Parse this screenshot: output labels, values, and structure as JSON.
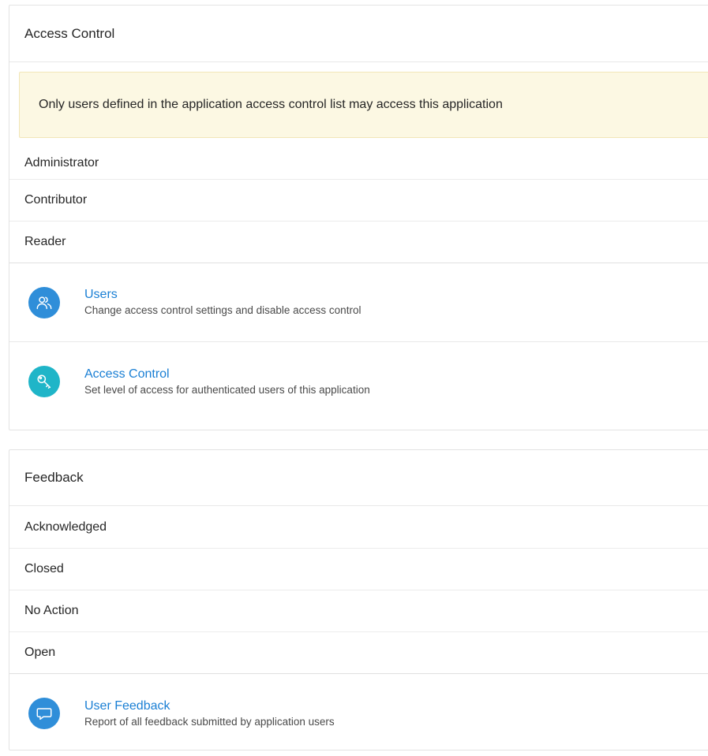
{
  "access_control": {
    "title": "Access Control",
    "alert": "Only users defined in the application access control list may access this application",
    "roles": [
      "Administrator",
      "Contributor",
      "Reader"
    ],
    "links": [
      {
        "title": "Users",
        "description": "Change access control settings and disable access control",
        "icon": "users-icon",
        "color": "#2f8ed9"
      },
      {
        "title": "Access Control",
        "description": "Set level of access for authenticated users of this application",
        "icon": "key-icon",
        "color": "#1fb5c8"
      }
    ]
  },
  "feedback": {
    "title": "Feedback",
    "statuses": [
      "Acknowledged",
      "Closed",
      "No Action",
      "Open"
    ],
    "links": [
      {
        "title": "User Feedback",
        "description": "Report of all feedback submitted by application users",
        "icon": "speech-bubble-icon",
        "color": "#2f8ed9"
      }
    ]
  },
  "colors": {
    "link": "#1a7fd4",
    "alert_background": "#fcf8e3"
  }
}
